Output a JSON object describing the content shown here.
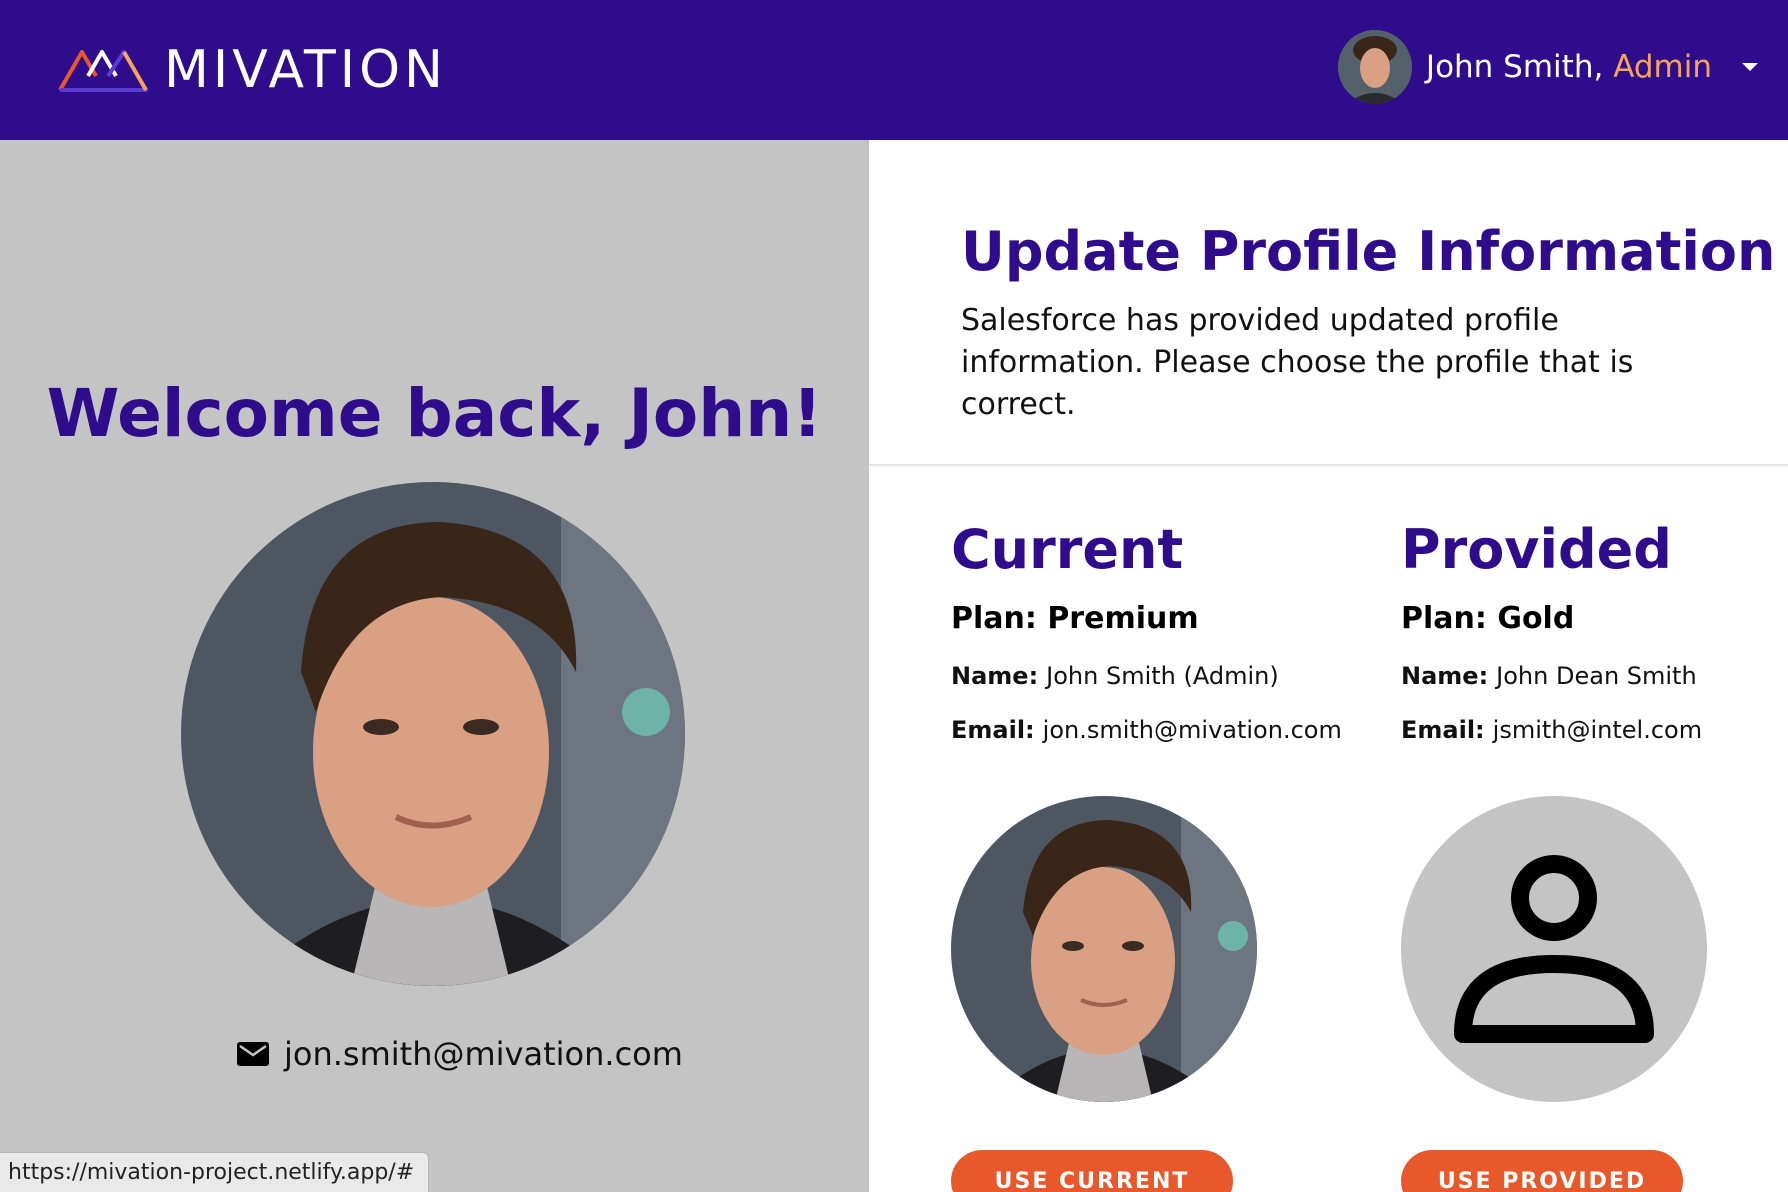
{
  "header": {
    "logo_text": "MIVATION",
    "user_name": "John Smith,",
    "user_role": "Admin"
  },
  "left": {
    "welcome": "Welcome back, John!",
    "email": "jon.smith@mivation.com"
  },
  "right": {
    "title": "Update Profile Information",
    "description": "Salesforce has provided updated profile information. Please choose the profile that is correct.",
    "current": {
      "title": "Current",
      "plan": "Plan: Premium",
      "name_label": "Name:",
      "name_value": "John Smith (Admin)",
      "email_label": "Email:",
      "email_value": "jon.smith@mivation.com",
      "button": "USE CURRENT"
    },
    "provided": {
      "title": "Provided",
      "plan": "Plan: Gold",
      "name_label": "Name:",
      "name_value": "John Dean Smith",
      "email_label": "Email:",
      "email_value": "jsmith@intel.com",
      "button": "USE PROVIDED"
    }
  },
  "status_bar": {
    "url": "https://mivation-project.netlify.app/#"
  },
  "colors": {
    "brand_purple": "#2f0c8c",
    "accent_orange": "#e9582a",
    "role_orange": "#f6a35a",
    "panel_gray": "#c4c4c4"
  },
  "icons": {
    "logo": "mountain-logo-icon",
    "caret": "caret-down-icon",
    "email": "mail-icon",
    "placeholder": "user-placeholder-icon"
  }
}
